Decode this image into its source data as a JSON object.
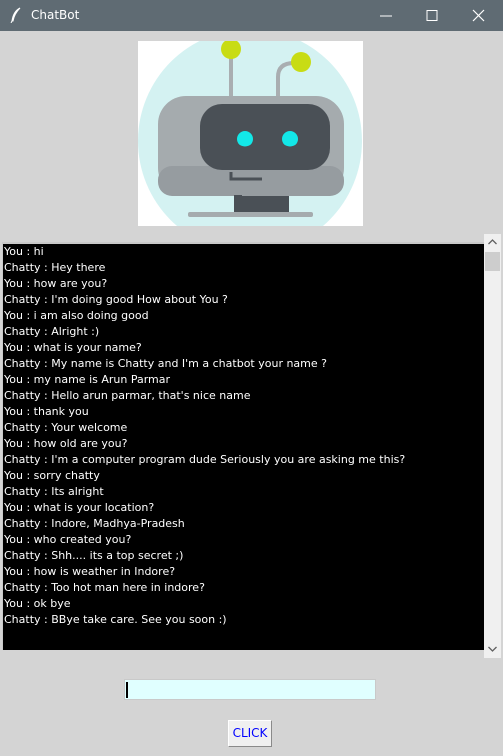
{
  "window": {
    "title": "ChatBot",
    "controls": [
      "minimize-icon",
      "maximize-icon",
      "close-icon"
    ]
  },
  "header": {
    "image_icon": "robot-icon"
  },
  "chat": {
    "lines": [
      "You : hi",
      "Chatty : Hey there",
      "You : how are you?",
      "Chatty : I'm doing good  How about You ?",
      "You : i am also doing good",
      "Chatty : Alright :)",
      "You : what is your name?",
      "Chatty : My name is Chatty and I'm a chatbot  your name ?",
      "You : my name is Arun Parmar",
      "Chatty : Hello arun parmar, that's nice name",
      "You : thank you",
      "Chatty : Your welcome",
      "You : how old are you?",
      "Chatty : I'm a computer program dude  Seriously you are asking me this?",
      "You : sorry chatty",
      "Chatty : Its alright",
      "You : what is your location?",
      "Chatty : Indore, Madhya-Pradesh",
      "You : who created you?",
      "Chatty : Shh.... its a top secret ;)",
      "You : how is weather in Indore?",
      "Chatty : Too hot man here in indore?",
      "You : ok bye",
      "Chatty : BBye take care. See you soon :)"
    ]
  },
  "input": {
    "value": ""
  },
  "send_button": {
    "label": "CLICK"
  },
  "colors": {
    "titlebar": "#5f6b73",
    "background": "#d4d4d4",
    "chat_background": "#000000",
    "chat_text": "#ffffff",
    "input_background": "#e0ffff",
    "button_text": "#0000ff",
    "robot_accent": "#c8dc14"
  }
}
